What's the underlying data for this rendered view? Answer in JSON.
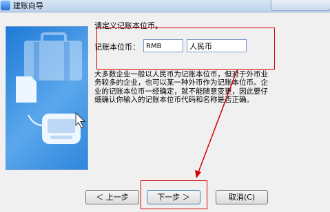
{
  "window": {
    "title": "建账向导"
  },
  "step": {
    "heading": "请定义记账本位币。",
    "currency_label": "记账本位币：",
    "currency_code": "RMB",
    "currency_name": "人民币",
    "description": "大多数企业一般以人民币为记账本位币，但对于外币业务较多的企业，也可以某一种外币作为记账本位币。企业的记账本位币一经确定，就不能随意变更，因此要仔细确认你输入的记账本位币代码和名称是否正确。"
  },
  "buttons": {
    "prev": "＜ 上一步",
    "next": "下一步 ＞",
    "cancel": "取消(C)"
  },
  "colors": {
    "annotation": "#d10000",
    "illustration": "#2f86dc"
  },
  "icons": [
    "wizard-icon",
    "document-icon",
    "keyboard-icon",
    "arrow-icon",
    "cursor-icon"
  ]
}
